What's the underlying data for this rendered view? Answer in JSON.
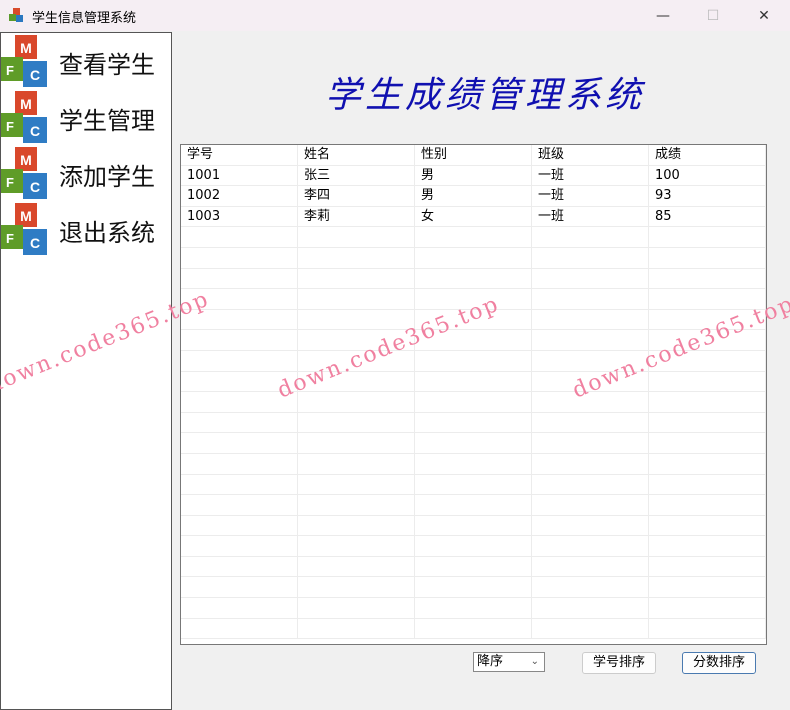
{
  "window": {
    "title": "学生信息管理系统",
    "minimize": "—",
    "maximize": "☐",
    "close": "✕"
  },
  "sidebar": {
    "items": [
      {
        "label": "查看学生"
      },
      {
        "label": "学生管理"
      },
      {
        "label": "添加学生"
      },
      {
        "label": "退出系统"
      }
    ]
  },
  "heading": "学生成绩管理系统",
  "table": {
    "headers": [
      "学号",
      "姓名",
      "性别",
      "班级",
      "成绩"
    ],
    "rows": [
      [
        "1001",
        "张三",
        "男",
        "一班",
        "100"
      ],
      [
        "1002",
        "李四",
        "男",
        "一班",
        "93"
      ],
      [
        "1003",
        "李莉",
        "女",
        "一班",
        "85"
      ]
    ]
  },
  "controls": {
    "order_value": "降序",
    "sort_by_id": "学号排序",
    "sort_by_score": "分数排序"
  },
  "watermark": "down.code365.top"
}
